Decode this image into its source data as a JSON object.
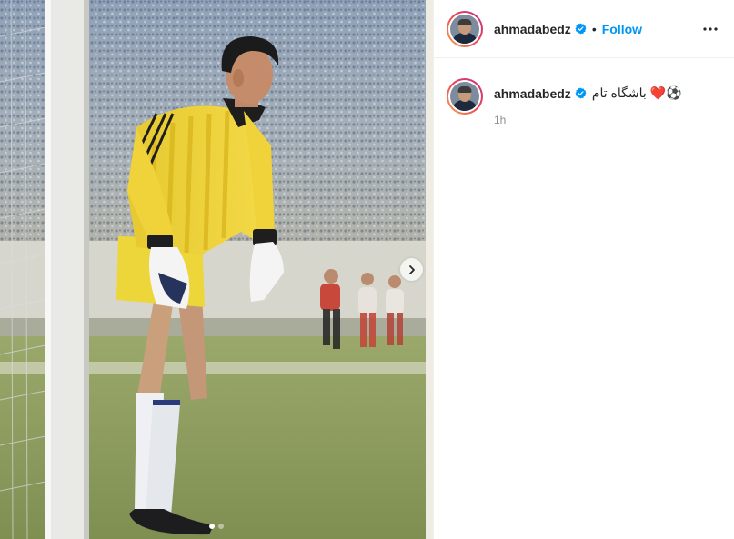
{
  "post": {
    "username": "ahmadabedz",
    "follow_label": "Follow",
    "separator": "•",
    "caption": "⚽️❤️ باشگاه تام",
    "timestamp": "1h"
  },
  "media": {
    "carousel_index": 1,
    "carousel_total": 2
  },
  "colors": {
    "follow": "#0095f6",
    "verified_badge": "#0095f6",
    "timestamp": "#8e8e8e"
  },
  "icons": {
    "verified": "verified-badge-icon",
    "more": "more-options-icon",
    "next": "chevron-right-icon"
  }
}
